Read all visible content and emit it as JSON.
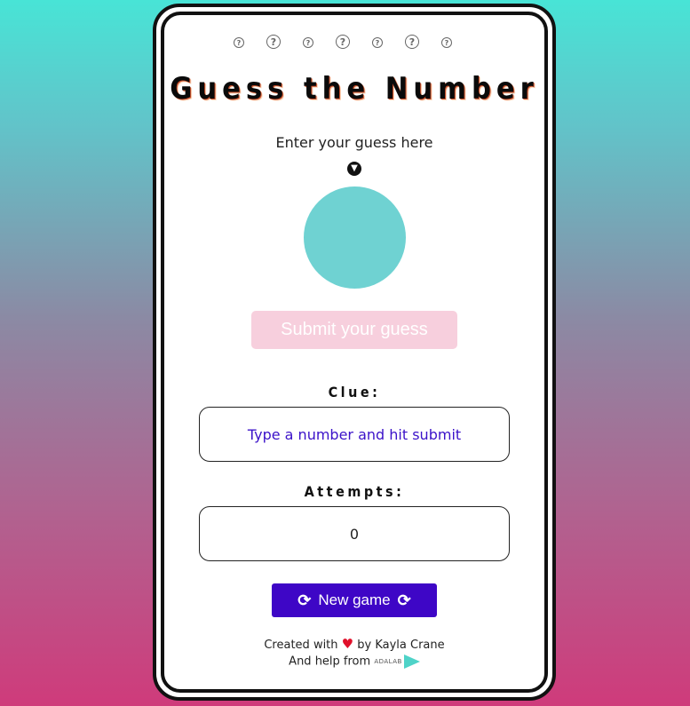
{
  "header": {
    "help_icons": [
      "?",
      "?",
      "?",
      "?",
      "?",
      "?",
      "?"
    ],
    "title": "Guess the Number"
  },
  "guess": {
    "prompt": "Enter your guess here",
    "arrow_icon": "arrow-down-circle-icon",
    "input_value": "",
    "submit_label": "Submit your guess"
  },
  "clue": {
    "label": "Clue:",
    "text": "Type a number and hit submit"
  },
  "attempts": {
    "label": "Attempts:",
    "value": "0"
  },
  "actions": {
    "new_game_label": "New game"
  },
  "footer": {
    "created_prefix": "Created with",
    "created_suffix": "by Kayla Crane",
    "help_prefix": "And help from",
    "logo_text": "ADALAB"
  },
  "colors": {
    "accent": "#3e06c6",
    "circle": "#6fd2d2",
    "submit_disabled": "#f7cfdd",
    "clue_text": "#3b12c9"
  }
}
